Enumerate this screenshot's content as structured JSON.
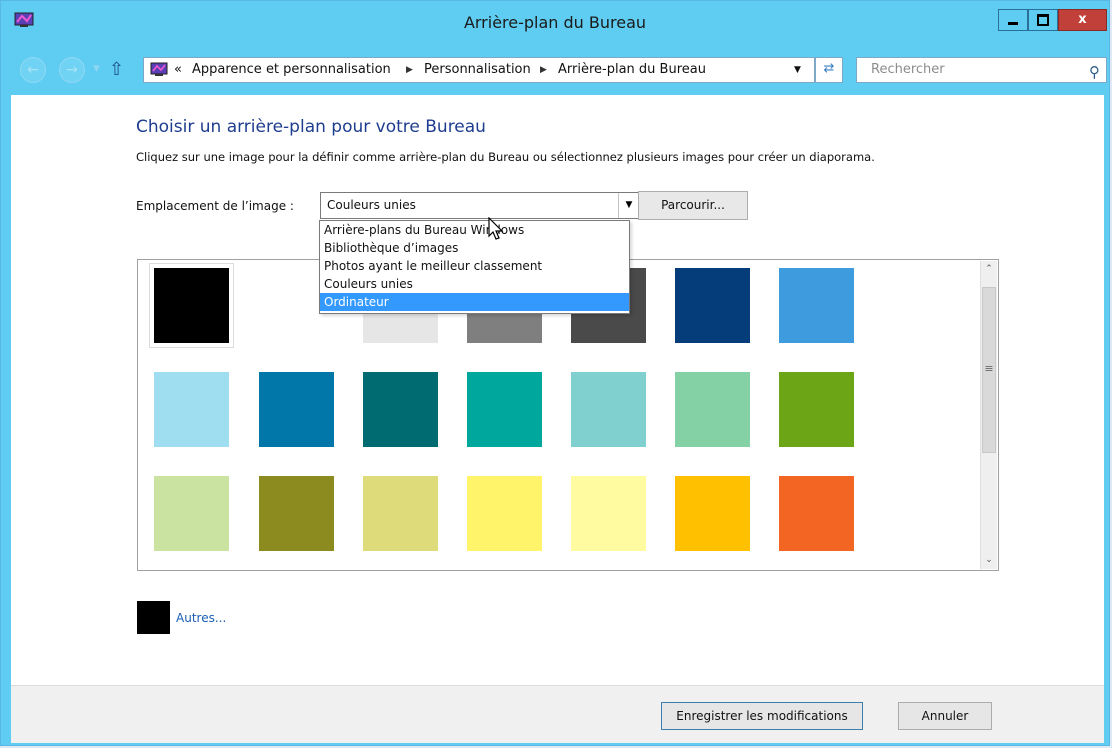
{
  "window": {
    "title": "Arrière-plan du Bureau",
    "minimize_icon": "minimize-icon",
    "maximize_icon": "maximize-icon",
    "close_label": "x"
  },
  "nav": {
    "back_icon": "back-arrow-icon",
    "forward_icon": "forward-arrow-icon",
    "up_icon": "up-arrow-icon",
    "address_prefix": "«",
    "breadcrumbs": [
      "Apparence et personnalisation",
      "Personnalisation",
      "Arrière-plan du Bureau"
    ],
    "refresh_icon": "refresh-icon",
    "search_placeholder": "Rechercher"
  },
  "main": {
    "heading": "Choisir un arrière-plan pour votre Bureau",
    "description": "Cliquez sur une image pour la définir comme arrière-plan du Bureau ou sélectionnez plusieurs images pour créer un diaporama.",
    "location_label": "Emplacement de l’image :",
    "location_value": "Couleurs unies",
    "browse_label": "Parcourir...",
    "dropdown_options": [
      "Arrière-plans du Bureau Windows",
      "Bibliothèque d’images",
      "Photos ayant le meilleur classement",
      "Couleurs unies",
      "Ordinateur"
    ],
    "dropdown_highlighted": "Ordinateur",
    "swatches": [
      "#000000",
      "#ffffff",
      "#e6e6e6",
      "#7f7f7f",
      "#4a4a4a",
      "#053c7a",
      "#3d9bde",
      "#9fddf1",
      "#0077a8",
      "#006b70",
      "#00a79c",
      "#7fd0cf",
      "#85d1a6",
      "#6ca617",
      "#cae3a1",
      "#8b8b1f",
      "#dedb7a",
      "#fff46a",
      "#fffba0",
      "#ffc000",
      "#f26522"
    ],
    "others_label": "Autres...",
    "others_color": "#000000"
  },
  "footer": {
    "save_label": "Enregistrer les modifications",
    "cancel_label": "Annuler"
  }
}
